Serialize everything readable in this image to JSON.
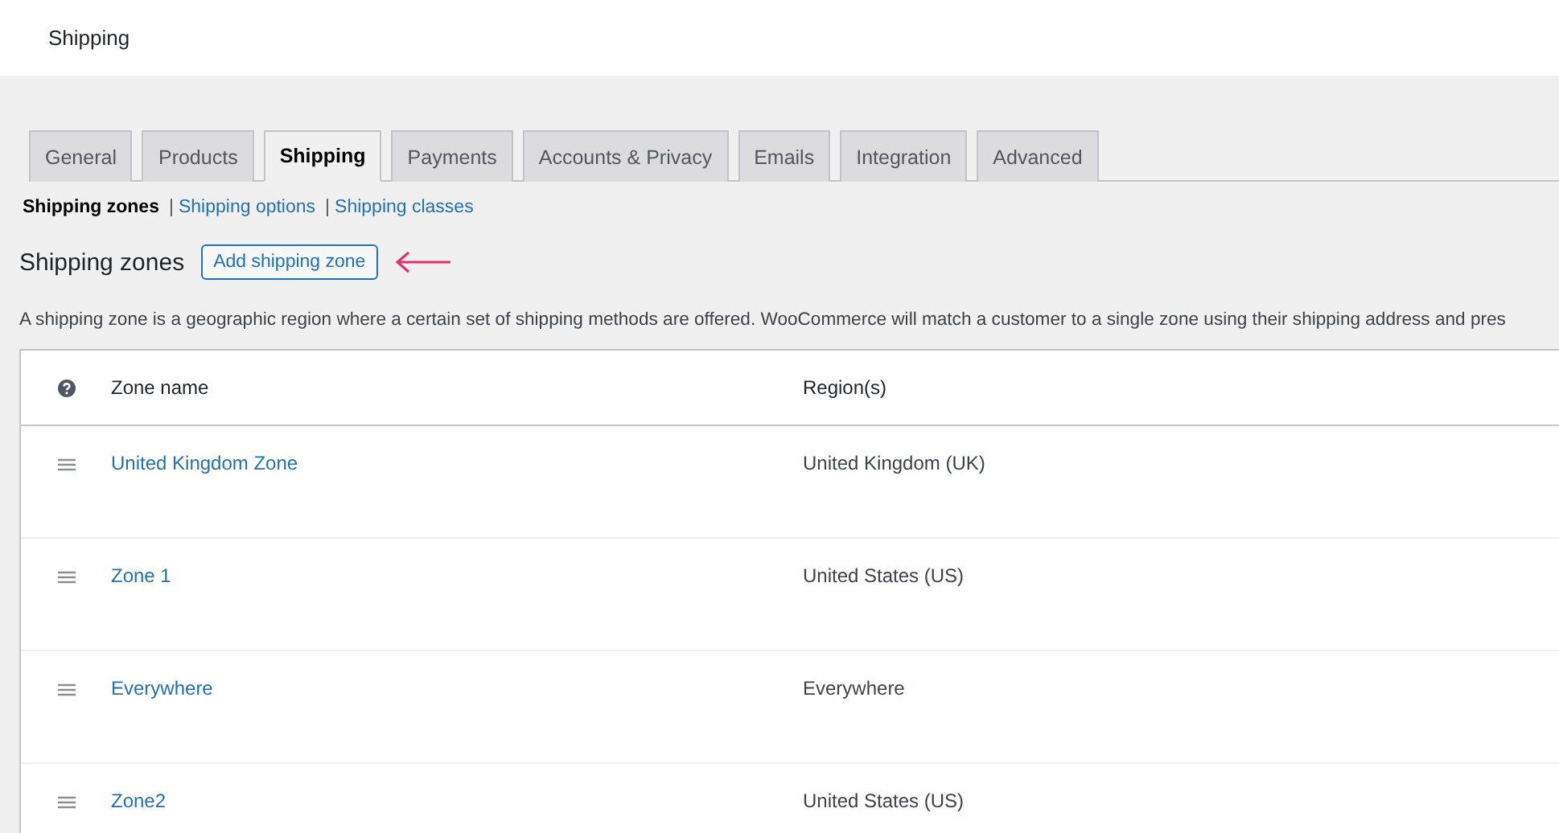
{
  "header": {
    "title": "Shipping"
  },
  "tabs": [
    {
      "label": "General",
      "selected": false
    },
    {
      "label": "Products",
      "selected": false
    },
    {
      "label": "Shipping",
      "selected": true
    },
    {
      "label": "Payments",
      "selected": false
    },
    {
      "label": "Accounts & Privacy",
      "selected": false
    },
    {
      "label": "Emails",
      "selected": false
    },
    {
      "label": "Integration",
      "selected": false
    },
    {
      "label": "Advanced",
      "selected": false
    }
  ],
  "subnav": [
    {
      "label": "Shipping zones",
      "selected": true
    },
    {
      "label": "Shipping options",
      "selected": false
    },
    {
      "label": "Shipping classes",
      "selected": false
    }
  ],
  "subnav_separator": "|",
  "section": {
    "title": "Shipping zones",
    "button": "Add shipping zone",
    "description": "A shipping zone is a geographic region where a certain set of shipping methods are offered. WooCommerce will match a customer to a single zone using their shipping address and pres"
  },
  "table": {
    "columns": [
      "Zone name",
      "Region(s)"
    ],
    "rows": [
      {
        "zone": "United Kingdom Zone",
        "region": "United Kingdom (UK)"
      },
      {
        "zone": "Zone 1",
        "region": "United States (US)"
      },
      {
        "zone": "Everywhere",
        "region": "Everywhere"
      },
      {
        "zone": "Zone2",
        "region": "United States (US)"
      }
    ]
  }
}
